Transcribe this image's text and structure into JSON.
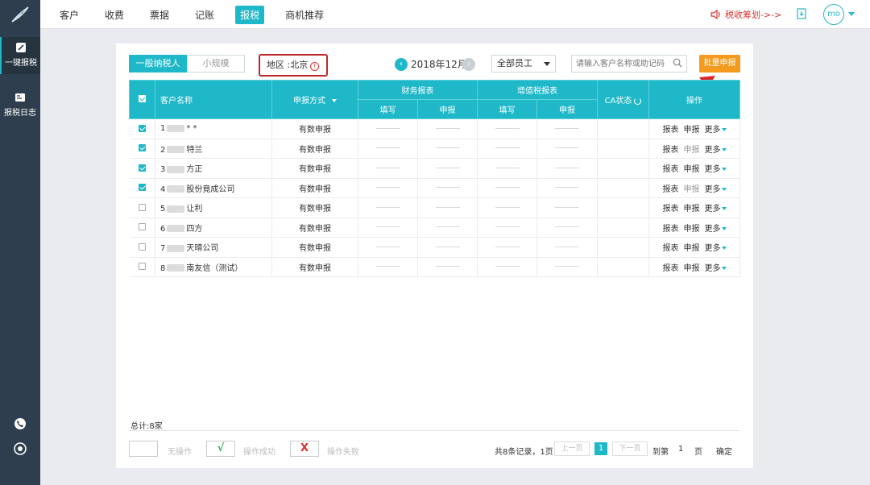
{
  "nav": {
    "items": [
      "客户",
      "收费",
      "票据",
      "记账",
      "报税",
      "商机推荐"
    ],
    "active_index": 4,
    "promo": "税收筹划->->",
    "user_initials": "mo"
  },
  "sidebar": {
    "items": [
      {
        "label": "一键报税",
        "icon": "edit-icon",
        "active": true
      },
      {
        "label": "报税日志",
        "icon": "log-icon",
        "active": false
      }
    ],
    "bottom_icons": [
      "phone-icon",
      "headset-icon"
    ]
  },
  "toolbar": {
    "tabs": [
      "一般纳税人",
      "小规模"
    ],
    "active_tab": 0,
    "region": "地区 :北京",
    "month": "2018年12月",
    "staff": "全部员工",
    "search_placeholder": "请输入客户名称或助记码",
    "batch_button": "批量申报"
  },
  "table": {
    "headers": {
      "customer": "客户名称",
      "method": "申报方式",
      "finance_group": "财务报表",
      "vat_group": "增值税报表",
      "fill": "填写",
      "declare": "申报",
      "ca": "CA状态",
      "actions": "操作"
    },
    "rows": [
      {
        "index": "1",
        "name": "* *",
        "method": "有数申报",
        "checked": true,
        "declare_enabled": true
      },
      {
        "index": "2",
        "name": "特兰",
        "method": "有数申报",
        "checked": true,
        "declare_enabled": false
      },
      {
        "index": "3",
        "name": "方正",
        "method": "有数申报",
        "checked": true,
        "declare_enabled": true
      },
      {
        "index": "4",
        "name": "股份竟成公司",
        "method": "有数申报",
        "checked": true,
        "declare_enabled": false
      },
      {
        "index": "5",
        "name": "让利",
        "method": "有数申报",
        "checked": false,
        "declare_enabled": true
      },
      {
        "index": "6",
        "name": "四方",
        "method": "有数申报",
        "checked": false,
        "declare_enabled": true
      },
      {
        "index": "7",
        "name": "天晴公司",
        "method": "有数申报",
        "checked": false,
        "declare_enabled": true
      },
      {
        "index": "8",
        "name": "南友信（测试）",
        "method": "有数申报",
        "checked": false,
        "declare_enabled": true
      }
    ],
    "action_labels": {
      "report": "报表",
      "declare": "申报",
      "more": "更多"
    }
  },
  "footer": {
    "total": "总计:8家",
    "legend": [
      {
        "symbol": "",
        "label": "无操作"
      },
      {
        "symbol": "√",
        "label": "操作成功",
        "color": "#2fae4a"
      },
      {
        "symbol": "X",
        "label": "操作失败",
        "color": "#d9322e"
      }
    ],
    "records": "共8条记录，1页",
    "prev": "上一页",
    "current_page": "1",
    "next": "下一页",
    "goto": "到第",
    "goto_page": "1",
    "page_unit": "页",
    "confirm": "确定"
  },
  "colors": {
    "accent": "#1fb8c9",
    "sidebar": "#2e3e4e",
    "batch": "#f39a1f",
    "highlight": "#c0282b"
  }
}
